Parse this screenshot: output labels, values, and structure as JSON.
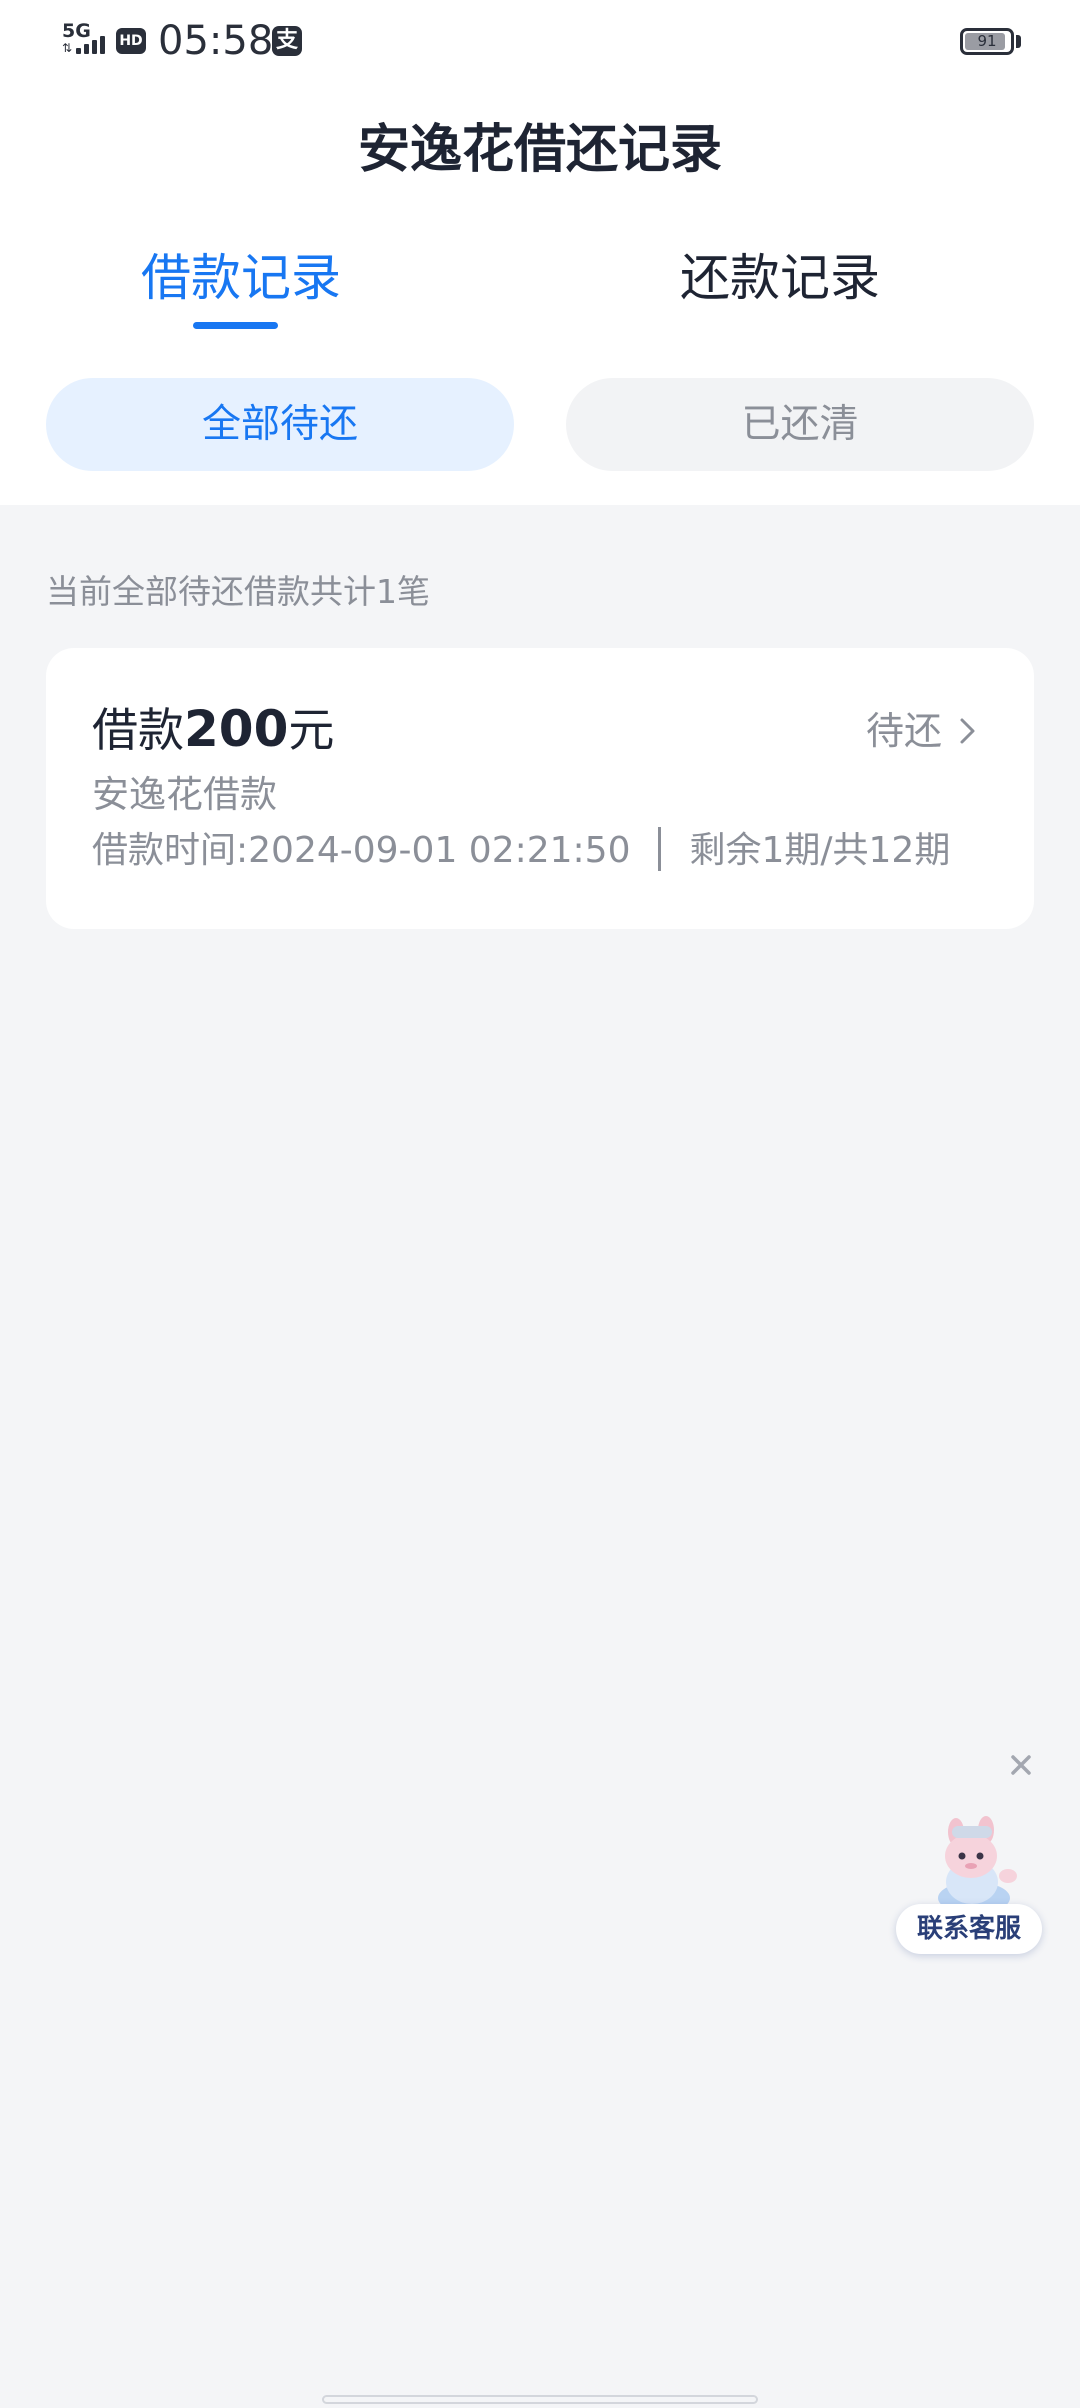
{
  "status_bar": {
    "network": "5G",
    "hd_badge": "HD",
    "time": "05:58",
    "app_badge": "支",
    "battery_level": "91"
  },
  "page": {
    "title": "安逸花借还记录"
  },
  "tabs": {
    "borrow": "借款记录",
    "repay": "还款记录",
    "active": "borrow"
  },
  "filters": {
    "all_pending": "全部待还",
    "cleared": "已还清",
    "active": "all_pending"
  },
  "summary": "当前全部待还借款共计1笔",
  "loans": [
    {
      "amount_prefix": "借款",
      "amount": "200",
      "amount_suffix": "元",
      "status": "待还",
      "product": "安逸花借款",
      "time": "借款时间:2024-09-01 02:21:50",
      "remaining": "剩余1期/共12期"
    }
  ],
  "floating_service": {
    "label": "联系客服"
  },
  "icons": {
    "chevron": "chevron-right-icon",
    "close": "close-icon",
    "mascot": "mascot-icon",
    "signal": "signal-icon",
    "battery": "battery-icon"
  },
  "colors": {
    "accent": "#1877f2",
    "accent_light": "#e6f1ff",
    "text_primary": "#1e2433",
    "text_secondary": "#8b8f98",
    "page_background": "#f4f5f7"
  }
}
